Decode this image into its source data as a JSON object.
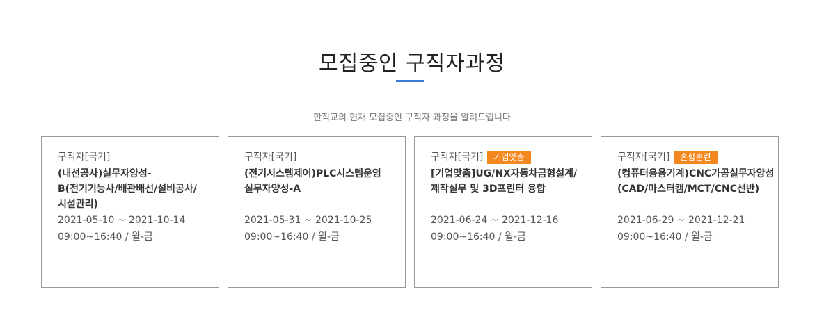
{
  "section": {
    "title": "모집중인 구직자과정",
    "subtitle": "한직교의 현재 모집중인 구직자 과정을 알려드립니다"
  },
  "accent_color": "#3a7bd5",
  "badge_color": "#f5871f",
  "courses": [
    {
      "category": "구직자[국기]",
      "badge": "",
      "name": "(내선공사)실무자양성-B(전기기능사/배관배선/설비공사/시설관리)",
      "period": "2021-05-10 ~ 2021-10-14",
      "time": "09:00~16:40 / 월-금"
    },
    {
      "category": "구직자[국기]",
      "badge": "",
      "name": "(전기시스템제어)PLC시스템운영 실무자양성-A",
      "period": "2021-05-31 ~ 2021-10-25",
      "time": "09:00~16:40 / 월-금"
    },
    {
      "category": "구직자[국기]",
      "badge": "기업맞춤",
      "name": "[기업맞춤]UG/NX자동차금형설계/제작실무 및 3D프린터 융합",
      "period": "2021-06-24 ~ 2021-12-16",
      "time": "09:00~16:40 / 월-금"
    },
    {
      "category": "구직자[국기]",
      "badge": "혼합훈련",
      "name": "(컴퓨터응용기계)CNC가공실무자양성(CAD/마스터캠/MCT/CNC선반)",
      "period": "2021-06-29 ~ 2021-12-21",
      "time": "09:00~16:40 / 월-금"
    }
  ]
}
